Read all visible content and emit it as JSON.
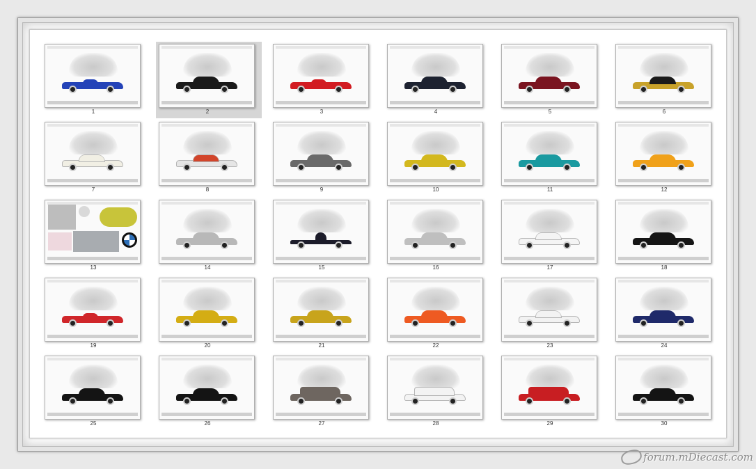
{
  "watermark": "forum.mDiecast.com",
  "selected_index": 2,
  "thumbnails": [
    {
      "num": "1",
      "color": "#2443b8",
      "cabin": "#2443b8",
      "type": "roadster"
    },
    {
      "num": "2",
      "color": "#1a1a1a",
      "cabin": "#1a1a1a",
      "type": "coupe"
    },
    {
      "num": "3",
      "color": "#d21c22",
      "cabin": "#d21c22",
      "type": "roadster"
    },
    {
      "num": "4",
      "color": "#1d2230",
      "cabin": "#1d2230",
      "type": "sedan"
    },
    {
      "num": "5",
      "color": "#7a1420",
      "cabin": "#7a1420",
      "type": "sedan"
    },
    {
      "num": "6",
      "color": "#c8a22a",
      "cabin": "#1a1a1a",
      "type": "race"
    },
    {
      "num": "7",
      "color": "#f1efe4",
      "cabin": "#f1efe4",
      "type": "sedan"
    },
    {
      "num": "8",
      "color": "#e5e5e5",
      "cabin": "#d2452b",
      "type": "race"
    },
    {
      "num": "9",
      "color": "#6a6a6a",
      "cabin": "#6a6a6a",
      "type": "sedan"
    },
    {
      "num": "10",
      "color": "#d3b81e",
      "cabin": "#d3b81e",
      "type": "coupe"
    },
    {
      "num": "11",
      "color": "#1a9aa0",
      "cabin": "#1a9aa0",
      "type": "coupe"
    },
    {
      "num": "12",
      "color": "#f0a11a",
      "cabin": "#f0a11a",
      "type": "coupe"
    },
    {
      "num": "13",
      "color": "",
      "cabin": "",
      "type": "collage"
    },
    {
      "num": "14",
      "color": "#b8b8b8",
      "cabin": "#b8b8b8",
      "type": "sedan"
    },
    {
      "num": "15",
      "color": "#1c1c2a",
      "cabin": "#1c1c2a",
      "type": "f1"
    },
    {
      "num": "16",
      "color": "#bfbfbf",
      "cabin": "#bfbfbf",
      "type": "coupe"
    },
    {
      "num": "17",
      "color": "#f4f4f4",
      "cabin": "#f4f4f4",
      "type": "race"
    },
    {
      "num": "18",
      "color": "#151515",
      "cabin": "#151515",
      "type": "coupe"
    },
    {
      "num": "19",
      "color": "#d0262a",
      "cabin": "#d0262a",
      "type": "roadster"
    },
    {
      "num": "20",
      "color": "#d4ad14",
      "cabin": "#d4ad14",
      "type": "coupe"
    },
    {
      "num": "21",
      "color": "#c8a41c",
      "cabin": "#c8a41c",
      "type": "coupe"
    },
    {
      "num": "22",
      "color": "#ee5a22",
      "cabin": "#ee5a22",
      "type": "race"
    },
    {
      "num": "23",
      "color": "#f2f2f2",
      "cabin": "#f2f2f2",
      "type": "coupe"
    },
    {
      "num": "24",
      "color": "#1f2a6a",
      "cabin": "#1f2a6a",
      "type": "sedan"
    },
    {
      "num": "25",
      "color": "#141414",
      "cabin": "#141414",
      "type": "sedan"
    },
    {
      "num": "26",
      "color": "#141414",
      "cabin": "#141414",
      "type": "sedan"
    },
    {
      "num": "27",
      "color": "#6e6660",
      "cabin": "#6e6660",
      "type": "suv"
    },
    {
      "num": "28",
      "color": "#f3f3f3",
      "cabin": "#f3f3f3",
      "type": "suv"
    },
    {
      "num": "29",
      "color": "#c81e22",
      "cabin": "#c81e22",
      "type": "suv"
    },
    {
      "num": "30",
      "color": "#141414",
      "cabin": "#141414",
      "type": "sedan"
    }
  ]
}
